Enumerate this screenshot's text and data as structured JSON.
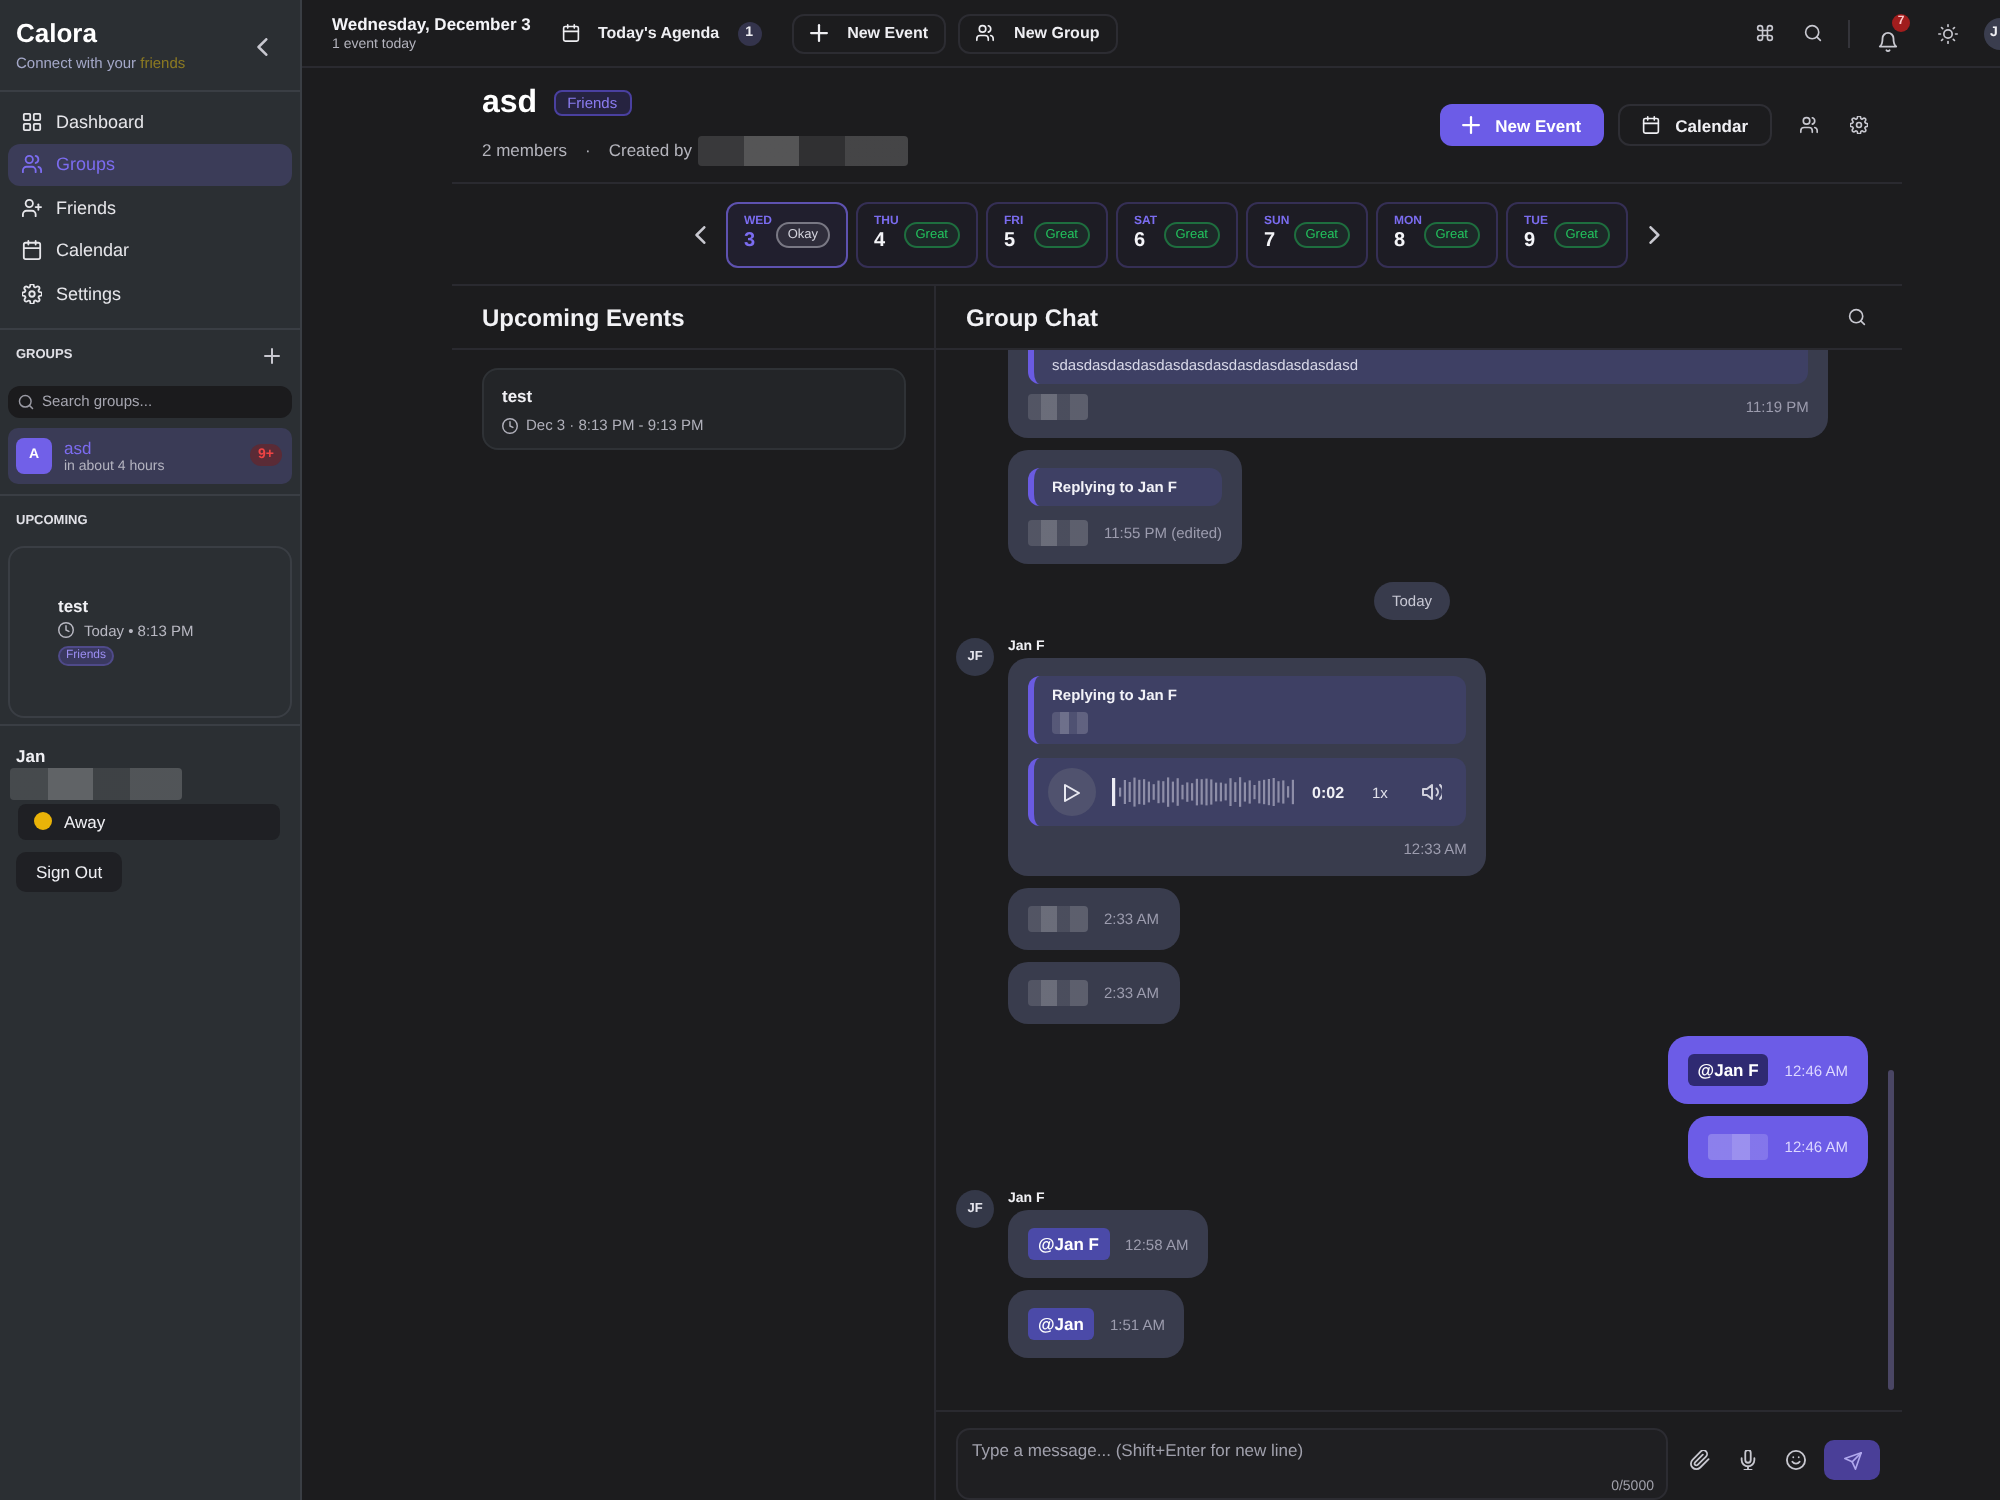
{
  "sidebar": {
    "brand": "Calora",
    "tagline": "Connect with your",
    "tagline_accent": "friends",
    "nav": [
      {
        "label": "Dashboard",
        "selected": false
      },
      {
        "label": "Groups",
        "selected": true
      },
      {
        "label": "Friends",
        "selected": false
      },
      {
        "label": "Calendar",
        "selected": false
      },
      {
        "label": "Settings",
        "selected": false
      }
    ],
    "groups": {
      "heading": "GROUPS",
      "search": {
        "placeholder": "Search groups..."
      },
      "items": [
        {
          "initial": "A",
          "name": "asd",
          "subtitle": "in about 4 hours",
          "badge": "9+",
          "selected": true
        }
      ]
    },
    "upcoming": {
      "heading": "UPCOMING",
      "items": [
        {
          "title": "test",
          "when": "Today • 8:13 PM",
          "tag": "Friends"
        }
      ]
    },
    "user": {
      "name": "Jan",
      "status": {
        "label": "Away",
        "color": "#eab308"
      }
    },
    "sign_out": "Sign Out"
  },
  "topbar": {
    "date": "Wednesday, December 3",
    "summary": "1 event today",
    "agenda": {
      "label": "Today's Agenda",
      "count": "1"
    },
    "buttons": [
      "New Event",
      "New Group"
    ],
    "notifications": "7",
    "avatar": "J"
  },
  "group": {
    "name": "asd",
    "tag": "Friends",
    "members": "2 members",
    "separator": "·",
    "created_by": "Created by",
    "buttons": [
      {
        "label": "New Event",
        "kind": "primary"
      },
      {
        "label": "Calendar",
        "kind": "secondary"
      }
    ]
  },
  "days": [
    {
      "weekday": "WED",
      "day": "3",
      "mood": "Okay",
      "color": "#d4d4de",
      "selected": true
    },
    {
      "weekday": "THU",
      "day": "4",
      "mood": "Great",
      "color": "#22c55e",
      "selected": false
    },
    {
      "weekday": "FRI",
      "day": "5",
      "mood": "Great",
      "color": "#22c55e",
      "selected": false
    },
    {
      "weekday": "SAT",
      "day": "6",
      "mood": "Great",
      "color": "#22c55e",
      "selected": false
    },
    {
      "weekday": "SUN",
      "day": "7",
      "mood": "Great",
      "color": "#22c55e",
      "selected": false
    },
    {
      "weekday": "MON",
      "day": "8",
      "mood": "Great",
      "color": "#22c55e",
      "selected": false
    },
    {
      "weekday": "TUE",
      "day": "9",
      "mood": "Great",
      "color": "#22c55e",
      "selected": false
    }
  ],
  "events": {
    "title": "Upcoming Events",
    "items": [
      {
        "title": "test",
        "time": "Dec 3 · 8:13 PM - 9:13 PM"
      }
    ]
  },
  "chat": {
    "title": "Group Chat",
    "messages": [
      {
        "kind": "message",
        "own": false,
        "clipped": true,
        "parts": [
          {
            "kind": "quote",
            "text": "sdasdasdasdasdasdasdasdasdasdasdasdasd",
            "blurred": false
          },
          {
            "kind": "blurred"
          }
        ],
        "time": "11:19 PM"
      },
      {
        "kind": "message",
        "own": false,
        "clipped": false,
        "parts": [
          {
            "kind": "quote",
            "title": "Replying to Jan F",
            "blurred": false
          },
          {
            "kind": "blurred"
          }
        ],
        "time": "11:55 PM (edited)"
      },
      {
        "kind": "divider",
        "label": "Today"
      },
      {
        "kind": "message",
        "own": false,
        "clipped": false,
        "author": "Jan F",
        "initials": "JF",
        "parts": [
          {
            "kind": "quote",
            "title": "Replying to Jan F",
            "blurred": true
          },
          {
            "kind": "audio",
            "duration": "0:02",
            "speed": "1x"
          }
        ],
        "time": "12:33 AM"
      },
      {
        "kind": "message",
        "own": false,
        "clipped": false,
        "parts": [
          {
            "kind": "blurred"
          }
        ],
        "time": "2:33 AM"
      },
      {
        "kind": "message",
        "own": false,
        "clipped": false,
        "parts": [
          {
            "kind": "blurred"
          }
        ],
        "time": "2:33 AM"
      },
      {
        "kind": "message",
        "own": true,
        "clipped": false,
        "parts": [
          {
            "kind": "mention",
            "text": "@Jan F"
          }
        ],
        "time": "12:46 AM"
      },
      {
        "kind": "message",
        "own": true,
        "clipped": false,
        "parts": [
          {
            "kind": "blurred"
          }
        ],
        "time": "12:46 AM"
      },
      {
        "kind": "message",
        "own": false,
        "clipped": false,
        "author": "Jan F",
        "initials": "JF",
        "parts": [
          {
            "kind": "mention",
            "text": "@Jan F"
          }
        ],
        "time": "12:58 AM"
      },
      {
        "kind": "message",
        "own": false,
        "clipped": false,
        "parts": [
          {
            "kind": "mention",
            "text": "@Jan"
          }
        ],
        "time": "1:51 AM"
      }
    ],
    "composer": {
      "placeholder": "Type a message... (Shift+Enter for new line)",
      "counter": "0/5000"
    }
  }
}
